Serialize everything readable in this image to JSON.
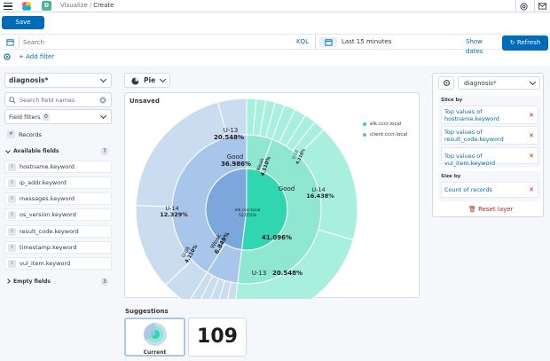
{
  "header": {
    "space_initial": "D",
    "breadcrumbs": [
      "Visualize",
      "Create"
    ]
  },
  "toolbar": {
    "save_label": "Save"
  },
  "query": {
    "search_placeholder": "Search",
    "language": "KQL",
    "time_range": "Last 15 minutes",
    "show_dates_label": "Show dates",
    "refresh_label": "Refresh"
  },
  "filters": {
    "add_filter_label": "+ Add filter"
  },
  "data_panel": {
    "index_pattern": "diagnosis*",
    "field_search_placeholder": "Search field names",
    "field_filters_label": "Field filters",
    "field_filters_count": "0",
    "records_label": "Records",
    "available_fields_label": "Available fields",
    "available_count": "7",
    "fields": [
      {
        "name": "hostname.keyword",
        "type": "t"
      },
      {
        "name": "ip_addr.keyword",
        "type": "t"
      },
      {
        "name": "messages.keyword",
        "type": "t"
      },
      {
        "name": "os_version.keyword",
        "type": "t"
      },
      {
        "name": "result_code.keyword",
        "type": "t"
      },
      {
        "name": "timestamp.keyword",
        "type": "t"
      },
      {
        "name": "vul_item.keyword",
        "type": "t"
      }
    ],
    "empty_fields_label": "Empty fields",
    "empty_count": "3"
  },
  "workspace": {
    "chart_type_label": "Pie",
    "title": "Unsaved",
    "legend": [
      {
        "label": "elk.cccr.local",
        "color": "#2fd6b0"
      },
      {
        "label": "client.cccr.local",
        "color": "#7ba7dd"
      }
    ],
    "chart_labels": {
      "center_host": "elk.cccr.local",
      "center_pct": "52.055%",
      "u13_left": "U-13",
      "u13_left_pct": "20.548%",
      "good_left": "Good",
      "good_left_pct": "36.986%",
      "u14_left": "U-14",
      "u14_left_pct": "12.329%",
      "u08": "U-08",
      "u08_pct": "4.110%",
      "weak_left": "Weak",
      "weak_left_pct": "6.849%",
      "good_right": "Good",
      "u14_right": "U-14",
      "u14_right_pct": "16.438%",
      "right_mid_pct": "41.096%",
      "u13_right": "U-13",
      "u13_right_pct": "20.548%",
      "weak_right": "Weak",
      "weak_right_pct": "4.110%",
      "u10_top": "U-10",
      "u10_top_pct": "4.110%"
    },
    "suggestions_title": "Suggestions",
    "suggestion_current_label": "Current",
    "suggestion_metric_value": "109"
  },
  "config_panel": {
    "layer_index": "diagnosis*",
    "slice_by_label": "Slice by",
    "slice_by": [
      "Top values of hostname.keyword",
      "Top values of result_code.keyword",
      "Top values of vul_item.keyword"
    ],
    "size_by_label": "Size by",
    "size_by": [
      "Count of records"
    ],
    "reset_layer_label": "Reset layer"
  },
  "colors": {
    "primary": "#006bb8",
    "danger": "#bd271e",
    "teal": "#2fd6b0",
    "blue": "#7ba7dd"
  }
}
